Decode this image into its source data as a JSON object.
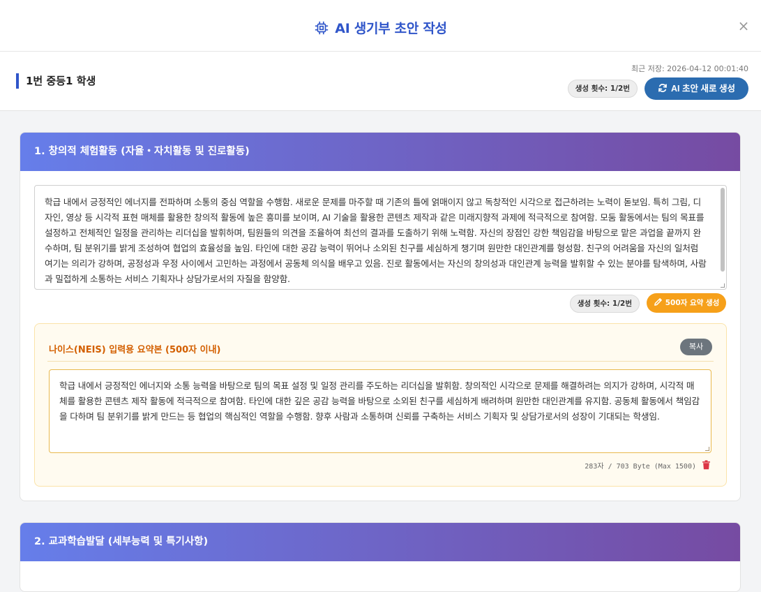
{
  "modal": {
    "title": "AI 생기부 초안 작성",
    "close_label": "×"
  },
  "student": {
    "name": "1번 중등1 학생",
    "last_saved": "최근 저장: 2026-04-12 00:01:40",
    "generation_count": "생성 횟수: 1/2번",
    "regenerate_label": "AI 초안 새로 생성"
  },
  "sections": [
    {
      "title": "1. 창의적 체험활동 (자율・자치활동 및 진로활동)",
      "draft_text": "학급 내에서 긍정적인 에너지를 전파하며 소통의 중심 역할을 수행함. 새로운 문제를 마주할 때 기존의 틀에 얽매이지 않고 독창적인 시각으로 접근하려는 노력이 돋보임. 특히 그림, 디자인, 영상 등 시각적 표현 매체를 활용한 창의적 활동에 높은 흥미를 보이며, AI 기술을 활용한 콘텐츠 제작과 같은 미래지향적 과제에 적극적으로 참여함. 모둠 활동에서는 팀의 목표를 설정하고 전체적인 일정을 관리하는 리더십을 발휘하며, 팀원들의 의견을 조율하여 최선의 결과를 도출하기 위해 노력함. 자신의 장점인 강한 책임감을 바탕으로 맡은 과업을 끝까지 완수하며, 팀 분위기를 밝게 조성하여 협업의 효율성을 높임. 타인에 대한 공감 능력이 뛰어나 소외된 친구를 세심하게 챙기며 원만한 대인관계를 형성함. 친구의 어려움을 자신의 일처럼 여기는 의리가 강하며, 공정성과 우정 사이에서 고민하는 과정에서 공동체 의식을 배우고 있음. 진로 활동에서는 자신의 창의성과 대인관계 능력을 발휘할 수 있는 분야를 탐색하며, 사람과 밀접하게 소통하는 서비스 기획자나 상담가로서의 자질을 함양함.",
      "generation_count": "생성 횟수: 1/2번",
      "summary_button": "500자 요약 생성",
      "neis": {
        "title": "나이스(NEIS) 입력용 요약본 (500자 이내)",
        "copy_label": "복사",
        "summary_text": "학급 내에서 긍정적인 에너지와 소통 능력을 바탕으로 팀의 목표 설정 및 일정 관리를 주도하는 리더십을 발휘함. 창의적인 시각으로 문제를 해결하려는 의지가 강하며, 시각적 매체를 활용한 콘텐츠 제작 활동에 적극적으로 참여함. 타인에 대한 깊은 공감 능력을 바탕으로 소외된 친구를 세심하게 배려하며 원만한 대인관계를 유지함. 공동체 활동에서 책임감을 다하며 팀 분위기를 밝게 만드는 등 협업의 핵심적인 역할을 수행함. 향후 사람과 소통하며 신뢰를 구축하는 서비스 기획자 및 상담가로서의 성장이 기대되는 학생임.",
        "byte_count": "283자 / 703 Byte (Max 1500)"
      }
    },
    {
      "title": "2. 교과학습발달 (세부능력 및 특기사항)"
    }
  ],
  "colors": {
    "accent_blue": "#2f55c9",
    "regen_button": "#2b6cb0",
    "summary_button": "#f6a01a",
    "neis_title": "#d35f00",
    "header_gradient_start": "#667eea",
    "header_gradient_end": "#764ba2",
    "trash": "#dc3545"
  },
  "icons": {
    "title_icon": "chip-icon",
    "regen_icon": "sync-icon",
    "summary_icon": "pencil-icon",
    "delete_icon": "trash-icon",
    "close_icon": "close-icon"
  }
}
